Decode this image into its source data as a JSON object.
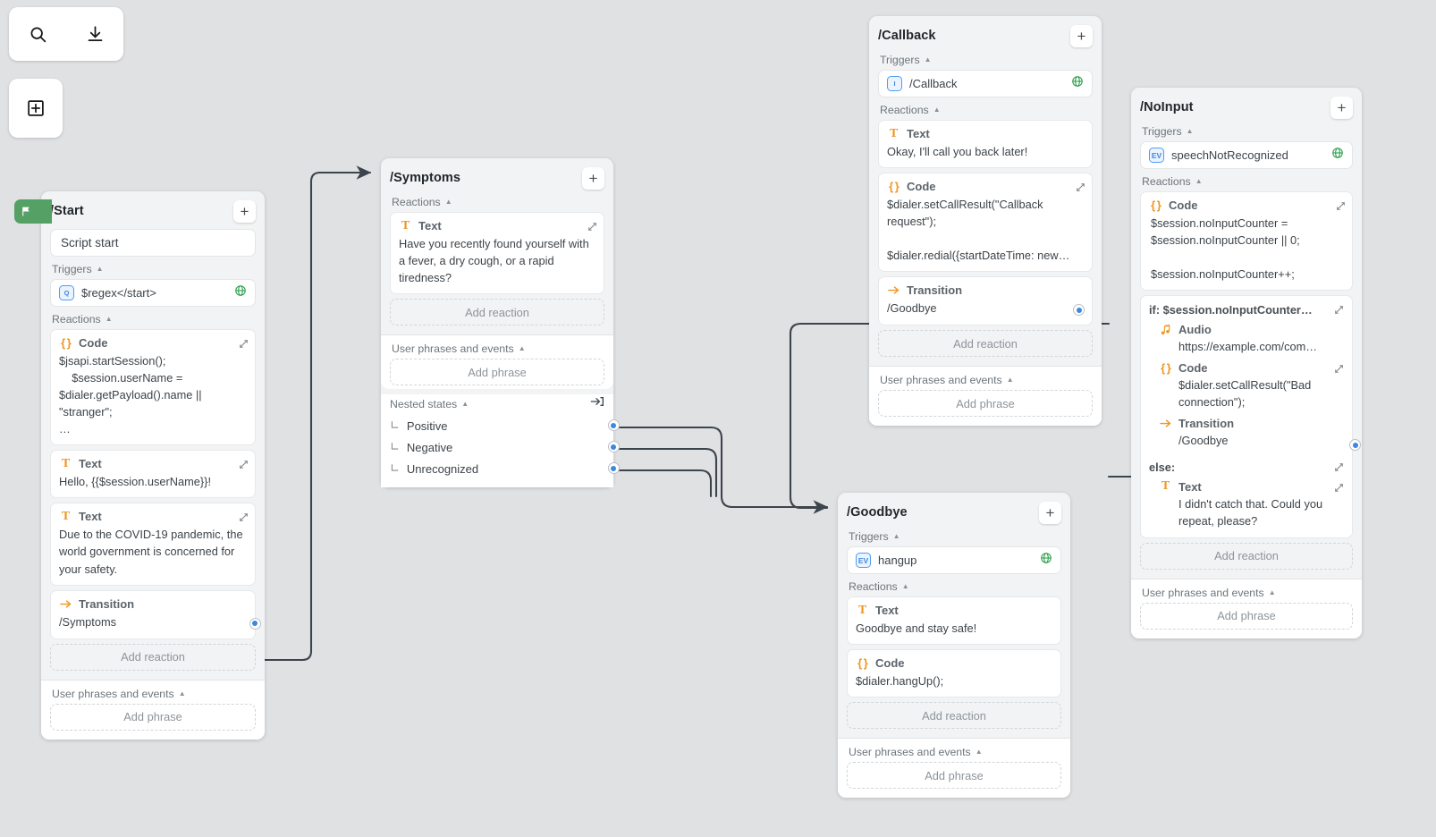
{
  "toolbar": {
    "search_icon": "search-icon",
    "download_icon": "download-icon",
    "add_state_icon": "add-state-icon"
  },
  "labels": {
    "triggers": "Triggers",
    "reactions": "Reactions",
    "user_phrases": "User phrases and events",
    "nested_states": "Nested states",
    "add_reaction": "Add reaction",
    "add_phrase": "Add phrase",
    "type_text": "Text",
    "type_code": "Code",
    "type_transition": "Transition",
    "type_audio": "Audio",
    "plus": "+"
  },
  "colors": {
    "canvas": "#e0e1e3",
    "node_header": "#f2f3f4",
    "accent_orange": "#f0951f",
    "accent_blue": "#3d87e0",
    "start_green": "#54a065",
    "edge": "#3c444d"
  },
  "nodes": {
    "start": {
      "title": "/Start",
      "name_value": "Script start",
      "trigger": {
        "badge": "Q",
        "text": "$regex</start>",
        "globe": true
      },
      "reactions": [
        {
          "type": "Code",
          "icon": "code-icon",
          "body": "$jsapi.startSession();\n    $session.userName = $dialer.getPayload().name || \"stranger\";\n…"
        },
        {
          "type": "Text",
          "icon": "text-icon",
          "body": "Hello, {{$session.userName}}!"
        },
        {
          "type": "Text",
          "icon": "text-icon",
          "body": "Due to the COVID-19 pandemic, the world government is concerned for your safety."
        },
        {
          "type": "Transition",
          "icon": "transition-icon",
          "body": "/Symptoms",
          "port": true
        }
      ]
    },
    "symptoms": {
      "title": "/Symptoms",
      "reactions": [
        {
          "type": "Text",
          "icon": "text-icon",
          "body": "Have you recently found yourself with a fever, a dry cough, or a rapid tiredness?"
        }
      ],
      "nested": [
        "Positive",
        "Negative",
        "Unrecognized"
      ]
    },
    "callback": {
      "title": "/Callback",
      "trigger": {
        "badge": "I",
        "text": "/Callback",
        "globe": true
      },
      "reactions": [
        {
          "type": "Text",
          "icon": "text-icon",
          "body": "Okay, I'll call you back later!"
        },
        {
          "type": "Code",
          "icon": "code-icon",
          "body": "$dialer.setCallResult(\"Callback request\");\n\n$dialer.redial({startDateTime: new…"
        },
        {
          "type": "Transition",
          "icon": "transition-icon",
          "body": "/Goodbye",
          "port": true
        }
      ]
    },
    "goodbye": {
      "title": "/Goodbye",
      "trigger": {
        "badge": "EV",
        "text": "hangup",
        "globe": true
      },
      "reactions": [
        {
          "type": "Text",
          "icon": "text-icon",
          "body": "Goodbye and stay safe!"
        },
        {
          "type": "Code",
          "icon": "code-icon",
          "body": "$dialer.hangUp();"
        }
      ]
    },
    "noinput": {
      "title": "/NoInput",
      "trigger": {
        "badge": "EV",
        "text": "speechNotRecognized",
        "globe": true
      },
      "code": {
        "type": "Code",
        "icon": "code-icon",
        "body": "$session.noInputCounter = $session.noInputCounter || 0;\n\n$session.noInputCounter++;"
      },
      "if_label": "if: $session.noInputCounter…",
      "if_items": [
        {
          "type": "Audio",
          "icon": "audio-icon",
          "body": "https://example.com/com…"
        },
        {
          "type": "Code",
          "icon": "code-icon",
          "body": "$dialer.setCallResult(\"Bad connection\");"
        },
        {
          "type": "Transition",
          "icon": "transition-icon",
          "body": "/Goodbye",
          "port": true
        }
      ],
      "else_label": "else:",
      "else_items": [
        {
          "type": "Text",
          "icon": "text-icon",
          "body": "I didn't catch that. Could you repeat, please?"
        }
      ]
    }
  }
}
